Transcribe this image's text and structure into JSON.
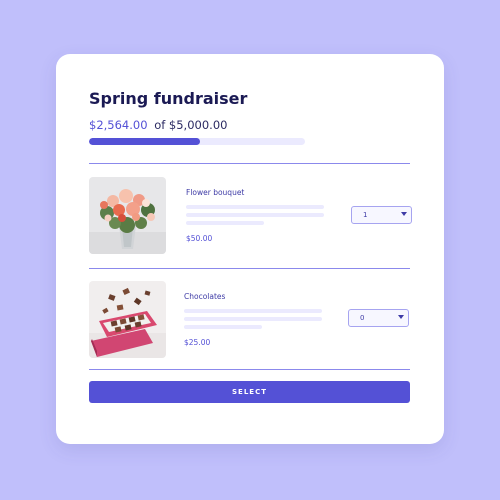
{
  "fundraiser": {
    "title": "Spring fundraiser",
    "raised": "$2,564.00",
    "goal": "of $5,000.00",
    "progress": 0.5128
  },
  "items": [
    {
      "name": "Flower bouquet",
      "price": "$50.00",
      "quantity": "1",
      "image": "flower-bouquet-photo"
    },
    {
      "name": "Chocolates",
      "price": "$25.00",
      "quantity": "0",
      "image": "chocolates-photo"
    }
  ],
  "actions": {
    "select_label": "SELECT"
  },
  "colors": {
    "background": "#c0bffb",
    "accent": "#5451d6",
    "title": "#1b1a54",
    "track": "#ebeafe"
  }
}
